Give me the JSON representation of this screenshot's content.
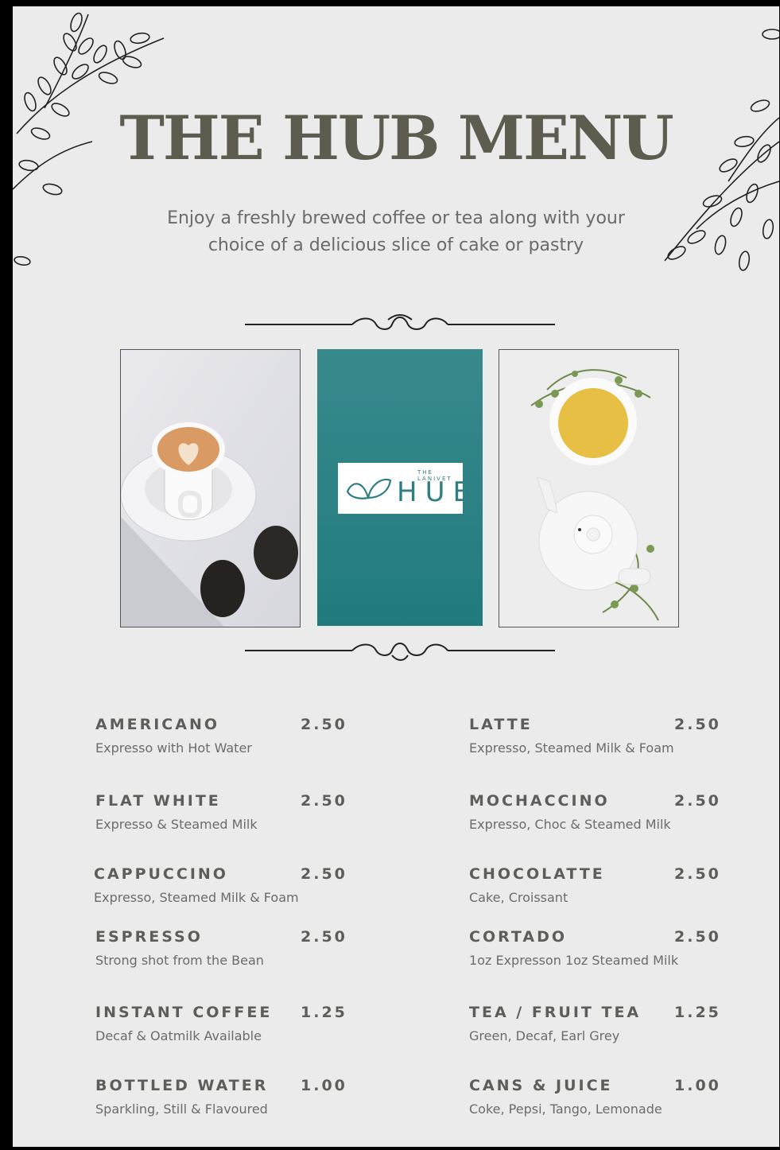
{
  "menu": {
    "title": "THE HUB MENU",
    "tagline_line1": "Enjoy a freshly brewed coffee or tea along with your",
    "tagline_line2": "choice of a delicious slice of cake or pastry"
  },
  "logo": {
    "small_text": "THE LANIVET",
    "main_text": "HUB"
  },
  "colors": {
    "background": "#ebebeb",
    "title": "#5e5b4f",
    "teal": "#2b8284"
  },
  "items_left": [
    {
      "name": "AMERICANO",
      "price": "2.50",
      "desc": "Expresso with Hot Water"
    },
    {
      "name": "FLAT WHITE",
      "price": "2.50",
      "desc": "Expresso & Steamed Milk"
    },
    {
      "name": "CAPPUCCINO",
      "price": "2.50",
      "desc": "Expresso, Steamed Milk & Foam"
    },
    {
      "name": "ESPRESSO",
      "price": "2.50",
      "desc": "Strong shot from the Bean"
    },
    {
      "name": "INSTANT COFFEE",
      "price": "1.25",
      "desc": "Decaf & Oatmilk Available"
    },
    {
      "name": "BOTTLED WATER",
      "price": "1.00",
      "desc": "Sparkling, Still & Flavoured"
    }
  ],
  "items_right": [
    {
      "name": "LATTE",
      "price": "2.50",
      "desc": "Expresso, Steamed Milk & Foam"
    },
    {
      "name": "MOCHACCINO",
      "price": "2.50",
      "desc": "Expresso, Choc & Steamed Milk"
    },
    {
      "name": "CHOCOLATTE",
      "price": "2.50",
      "desc": "Cake, Croissant"
    },
    {
      "name": "CORTADO",
      "price": "2.50",
      "desc": "1oz Expresson 1oz Steamed Milk"
    },
    {
      "name": "TEA / FRUIT TEA",
      "price": "1.25",
      "desc": "Green, Decaf, Earl Grey"
    },
    {
      "name": "CANS & JUICE",
      "price": "1.00",
      "desc": "Coke, Pepsi, Tango, Lemonade"
    }
  ]
}
